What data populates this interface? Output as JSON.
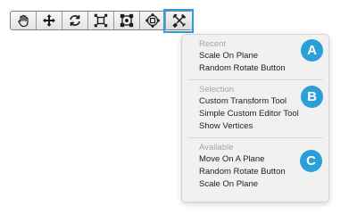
{
  "colors": {
    "accent": "#2b9fd8",
    "menu_background": "#f1f1f1",
    "header_text": "#a6a6a6",
    "item_text": "#222222"
  },
  "toolbar": {
    "tools": [
      {
        "icon": "hand-icon",
        "tooltip": ""
      },
      {
        "icon": "move-arrows-icon",
        "tooltip": ""
      },
      {
        "icon": "rotate-icon",
        "tooltip": ""
      },
      {
        "icon": "scale-icon",
        "tooltip": ""
      },
      {
        "icon": "rect-transform-icon",
        "tooltip": ""
      },
      {
        "icon": "transform-combined-icon",
        "tooltip": ""
      },
      {
        "icon": "custom-tools-icon",
        "tooltip": ""
      }
    ],
    "active_tool_index": 6
  },
  "menu": {
    "sections": [
      {
        "header": "Recent",
        "badge": "A",
        "items": [
          "Scale On Plane",
          "Random Rotate Button"
        ]
      },
      {
        "header": "Selection",
        "badge": "B",
        "items": [
          "Custom Transform Tool",
          "Simple Custom Editor Tool",
          "Show Vertices"
        ]
      },
      {
        "header": "Available",
        "badge": "C",
        "items": [
          "Move On A Plane",
          "Random Rotate Button",
          "Scale On Plane"
        ]
      }
    ]
  }
}
